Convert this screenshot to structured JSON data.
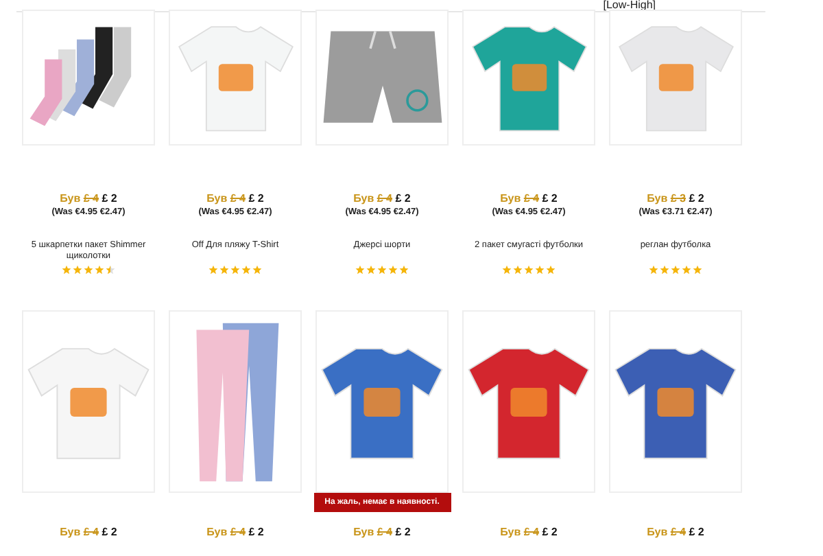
{
  "sort_label": "[Low-High]",
  "rows": [
    {
      "products": [
        {
          "image": {
            "kind": "socks",
            "color": "#e9a6c4"
          },
          "prefix": "Був",
          "old_price": "£ 4",
          "price": "£ 2",
          "was": "(Was €4.95 €2.47)",
          "name": "5 шкарпетки пакет Shimmer щиколотки",
          "stars": 4.5
        },
        {
          "image": {
            "kind": "tshirt",
            "color": "#f4f6f6"
          },
          "prefix": "Був",
          "old_price": "£ 4",
          "price": "£ 2",
          "was": "(Was €4.95 €2.47)",
          "name": "Off Для пляжу T-Shirt",
          "stars": 5
        },
        {
          "image": {
            "kind": "shorts",
            "color": "#9c9c9c"
          },
          "prefix": "Був",
          "old_price": "£ 4",
          "price": "£ 2",
          "was": "(Was €4.95 €2.47)",
          "name": "Джерсі шорти",
          "stars": 5
        },
        {
          "image": {
            "kind": "tshirt",
            "color": "#1fa59a"
          },
          "prefix": "Був",
          "old_price": "£ 4",
          "price": "£ 2",
          "was": "(Was €4.95 €2.47)",
          "name": "2 пакет смугасті футболки",
          "stars": 5
        },
        {
          "image": {
            "kind": "tshirt",
            "color": "#e8e8ea"
          },
          "prefix": "Був",
          "old_price": "£ 3",
          "price": "£ 2",
          "was": "(Was €3.71 €2.47)",
          "name": "реглан футболка",
          "stars": 5
        }
      ]
    },
    {
      "products": [
        {
          "image": {
            "kind": "tshirt",
            "color": "#f6f6f6"
          },
          "prefix": "Був",
          "old_price": "£ 4",
          "price": "£ 2"
        },
        {
          "image": {
            "kind": "leggings",
            "color": "#f2bfd0"
          },
          "prefix": "Був",
          "old_price": "£ 4",
          "price": "£ 2"
        },
        {
          "image": {
            "kind": "tshirt",
            "color": "#3a6fc4"
          },
          "notice": "На жаль, немає в наявності.",
          "prefix": "Був",
          "old_price": "£ 4",
          "price": "£ 2"
        },
        {
          "image": {
            "kind": "tshirt",
            "color": "#d3262e"
          },
          "prefix": "Був",
          "old_price": "£ 4",
          "price": "£ 2"
        },
        {
          "image": {
            "kind": "tshirt",
            "color": "#3c5fb4"
          },
          "prefix": "Був",
          "old_price": "£ 4",
          "price": "£ 2"
        }
      ]
    }
  ]
}
